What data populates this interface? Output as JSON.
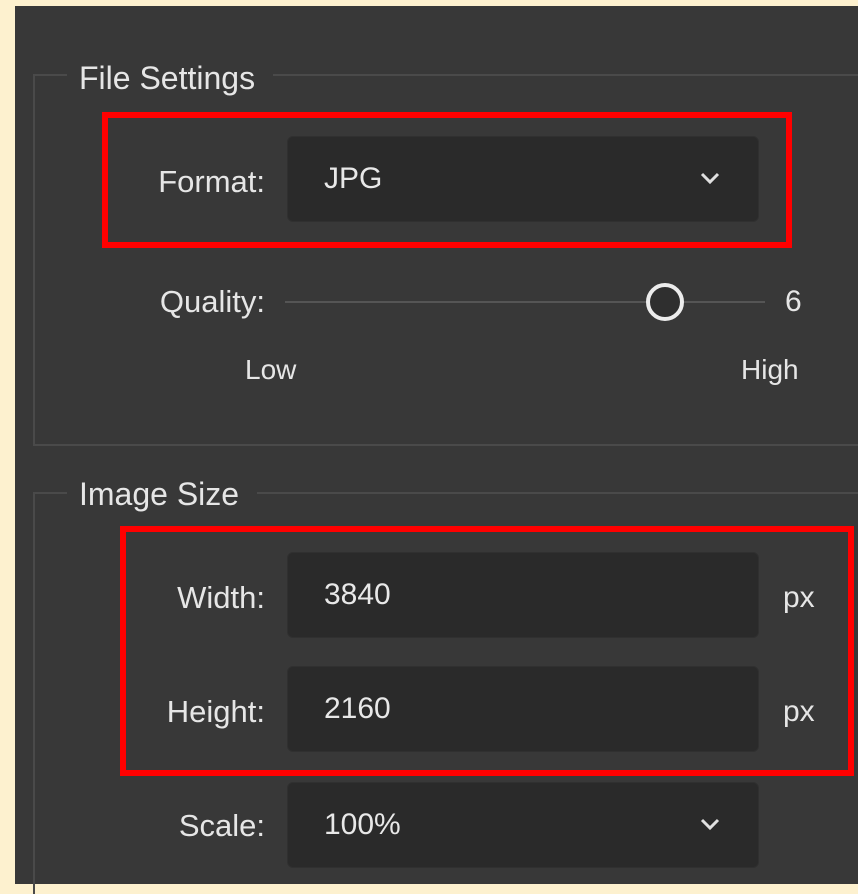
{
  "file_settings": {
    "title": "File Settings",
    "format": {
      "label": "Format:",
      "value": "JPG",
      "icon": "chevron-down-icon"
    },
    "quality": {
      "label": "Quality:",
      "value": "6",
      "low_label": "Low",
      "high_label": "High",
      "level_fraction": 0.72
    }
  },
  "image_size": {
    "title": "Image Size",
    "width": {
      "label": "Width:",
      "value": "3840",
      "unit": "px"
    },
    "height": {
      "label": "Height:",
      "value": "2160",
      "unit": "px"
    },
    "scale": {
      "label": "Scale:",
      "value": "100%",
      "icon": "chevron-down-icon"
    }
  },
  "colors": {
    "panel_bg": "#383838",
    "field_bg": "#2a2a2a",
    "highlight": "#ff0000",
    "page_bg": "#fdf1cf"
  }
}
